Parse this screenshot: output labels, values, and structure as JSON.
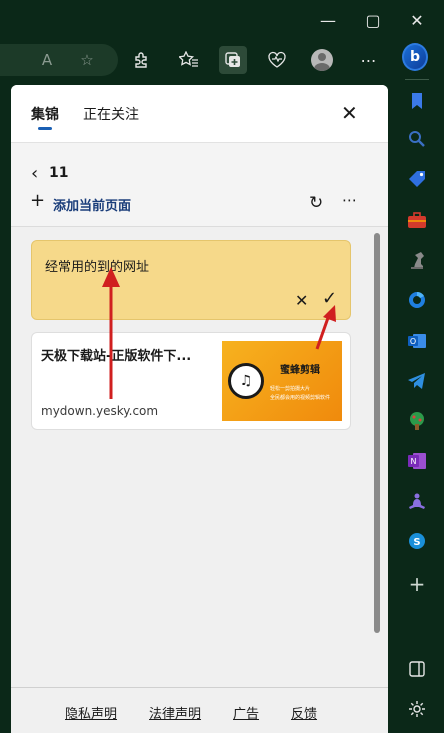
{
  "window": {
    "minimize_icon": "minimize-icon",
    "maximize_icon": "maximize-icon",
    "close_icon": "close-icon"
  },
  "toolbar": {
    "read_aloud": "A",
    "icons": [
      "read-aloud-icon",
      "favorite-star-icon",
      "extensions-icon",
      "favorites-icon",
      "collections-icon",
      "browser-essentials-icon",
      "profile-avatar-icon",
      "more-icon"
    ]
  },
  "sidebar": {
    "icons": [
      "copilot-icon",
      "bookmark-icon",
      "search-icon",
      "shopping-tag-icon",
      "tools-icon",
      "chess-icon",
      "microsoft365-icon",
      "outlook-icon",
      "telegram-icon",
      "game-tree-icon",
      "onenote-icon",
      "meditation-icon",
      "skype-icon",
      "add-icon",
      "split-screen-icon",
      "settings-icon"
    ],
    "copilot_label": "b"
  },
  "panel": {
    "tabs": [
      {
        "label": "集锦",
        "active": true
      },
      {
        "label": "正在关注",
        "active": false
      }
    ],
    "collection_title": "11",
    "add_page_label": "添加当前页面",
    "note": {
      "text": "经常用的到的网址"
    },
    "card": {
      "title": "天极下载站-正版软件下...",
      "domain": "mydown.yesky.com",
      "thumb_title": "蜜蜂剪辑",
      "thumb_sub1": "轻松一剪拍摄大片",
      "thumb_sub2": "全民都会用的视频剪辑软件"
    },
    "footer": [
      "隐私声明",
      "法律声明",
      "广告",
      "反馈"
    ]
  },
  "colors": {
    "background": "#0b2818",
    "note": "#f6d98a",
    "accent": "#1a5fb4",
    "arrow": "#d01f1f"
  }
}
